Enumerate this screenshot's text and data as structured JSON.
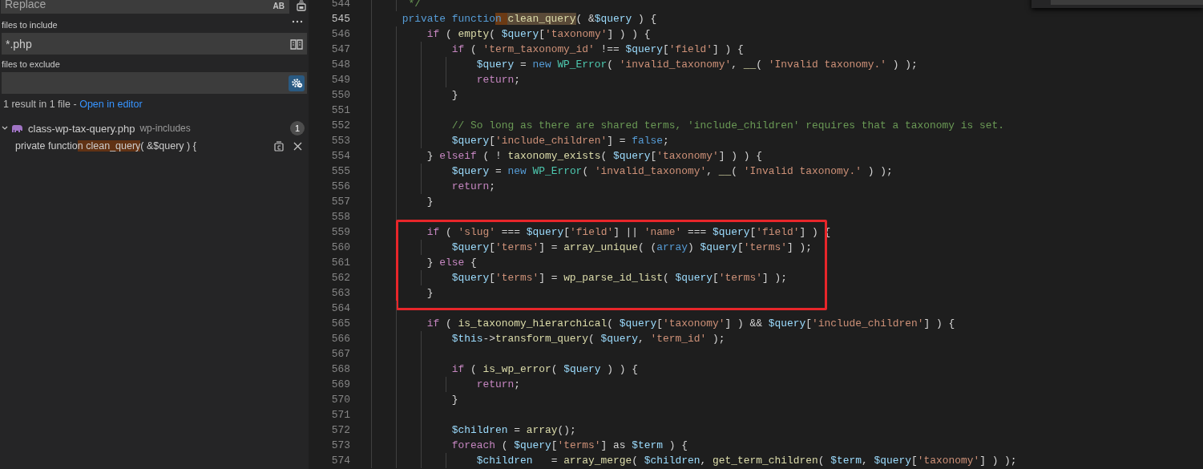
{
  "sidebar": {
    "replace_field": {
      "placeholder": "Replace",
      "case_button": "AB"
    },
    "include_field": {
      "label": "files to include",
      "value": "*.php",
      "toggle": {
        "selected": false
      }
    },
    "exclude_field": {
      "label": "files to exclude",
      "toggle": {
        "selected": true
      }
    },
    "summary": {
      "text": "1 result in 1 file - ",
      "link": "Open in editor"
    },
    "files": [
      {
        "name": "class-wp-tax-query.php",
        "folder": "wp-includes",
        "count": "1",
        "expanded": true,
        "matches": [
          {
            "segments": [
              {
                "text": "private functio",
                "match": false
              },
              {
                "text": "n clean_query",
                "match": true
              },
              {
                "text": "( &$query ) {",
                "match": false
              }
            ]
          }
        ]
      }
    ]
  },
  "editor": {
    "lines": [
      {
        "number": "544",
        "current": false,
        "boxed": false,
        "tokens": [
          {
            "kind": "comment",
            "text": "     */"
          }
        ]
      },
      {
        "number": "545",
        "current": true,
        "boxed": false,
        "tokens": [
          {
            "kind": "storage",
            "text": "    private functio"
          },
          {
            "kind": "match",
            "text": "n "
          },
          {
            "kind": "word",
            "text": "clean_query"
          },
          {
            "kind": "plain",
            "text": "( &"
          },
          {
            "kind": "var",
            "text": "$query"
          },
          {
            "kind": "plain",
            "text": " ) {"
          }
        ]
      },
      {
        "number": "546",
        "current": false,
        "boxed": false,
        "tokens": [
          {
            "kind": "control",
            "text": "        if"
          },
          {
            "kind": "plain",
            "text": " ( "
          },
          {
            "kind": "func",
            "text": "empty"
          },
          {
            "kind": "plain",
            "text": "( "
          },
          {
            "kind": "var",
            "text": "$query"
          },
          {
            "kind": "plain",
            "text": "["
          },
          {
            "kind": "string",
            "text": "'taxonomy'"
          },
          {
            "kind": "plain",
            "text": "] ) ) {"
          }
        ]
      },
      {
        "number": "547",
        "current": false,
        "boxed": false,
        "tokens": [
          {
            "kind": "control",
            "text": "            if"
          },
          {
            "kind": "plain",
            "text": " ( "
          },
          {
            "kind": "string",
            "text": "'term_taxonomy_id'"
          },
          {
            "kind": "plain",
            "text": " !== "
          },
          {
            "kind": "var",
            "text": "$query"
          },
          {
            "kind": "plain",
            "text": "["
          },
          {
            "kind": "string",
            "text": "'field'"
          },
          {
            "kind": "plain",
            "text": "] ) {"
          }
        ]
      },
      {
        "number": "548",
        "current": false,
        "boxed": false,
        "tokens": [
          {
            "kind": "var",
            "text": "                $query"
          },
          {
            "kind": "plain",
            "text": " = "
          },
          {
            "kind": "storage",
            "text": "new "
          },
          {
            "kind": "class",
            "text": "WP_Error"
          },
          {
            "kind": "plain",
            "text": "( "
          },
          {
            "kind": "string",
            "text": "'invalid_taxonomy'"
          },
          {
            "kind": "plain",
            "text": ", "
          },
          {
            "kind": "func",
            "text": "__"
          },
          {
            "kind": "plain",
            "text": "( "
          },
          {
            "kind": "string",
            "text": "'Invalid taxonomy.'"
          },
          {
            "kind": "plain",
            "text": " ) );"
          }
        ]
      },
      {
        "number": "549",
        "current": false,
        "boxed": false,
        "tokens": [
          {
            "kind": "control",
            "text": "                return"
          },
          {
            "kind": "plain",
            "text": ";"
          }
        ]
      },
      {
        "number": "550",
        "current": false,
        "boxed": false,
        "tokens": [
          {
            "kind": "plain",
            "text": "            }"
          }
        ]
      },
      {
        "number": "551",
        "current": false,
        "boxed": false
      },
      {
        "number": "552",
        "current": false,
        "boxed": false,
        "tokens": [
          {
            "kind": "comment",
            "text": "            // So long as there are shared terms, 'include_children' requires that a taxonomy is set."
          }
        ]
      },
      {
        "number": "553",
        "current": false,
        "boxed": false,
        "tokens": [
          {
            "kind": "var",
            "text": "            $query"
          },
          {
            "kind": "plain",
            "text": "["
          },
          {
            "kind": "string",
            "text": "'include_children'"
          },
          {
            "kind": "plain",
            "text": "] = "
          },
          {
            "kind": "storage",
            "text": "false"
          },
          {
            "kind": "plain",
            "text": ";"
          }
        ]
      },
      {
        "number": "554",
        "current": false,
        "boxed": false,
        "tokens": [
          {
            "kind": "plain",
            "text": "        } "
          },
          {
            "kind": "control",
            "text": "elseif"
          },
          {
            "kind": "plain",
            "text": " ( ! "
          },
          {
            "kind": "func",
            "text": "taxonomy_exists"
          },
          {
            "kind": "plain",
            "text": "( "
          },
          {
            "kind": "var",
            "text": "$query"
          },
          {
            "kind": "plain",
            "text": "["
          },
          {
            "kind": "string",
            "text": "'taxonomy'"
          },
          {
            "kind": "plain",
            "text": "] ) ) {"
          }
        ]
      },
      {
        "number": "555",
        "current": false,
        "boxed": false,
        "tokens": [
          {
            "kind": "var",
            "text": "            $query"
          },
          {
            "kind": "plain",
            "text": " = "
          },
          {
            "kind": "storage",
            "text": "new "
          },
          {
            "kind": "class",
            "text": "WP_Error"
          },
          {
            "kind": "plain",
            "text": "( "
          },
          {
            "kind": "string",
            "text": "'invalid_taxonomy'"
          },
          {
            "kind": "plain",
            "text": ", "
          },
          {
            "kind": "func",
            "text": "__"
          },
          {
            "kind": "plain",
            "text": "( "
          },
          {
            "kind": "string",
            "text": "'Invalid taxonomy.'"
          },
          {
            "kind": "plain",
            "text": " ) );"
          }
        ]
      },
      {
        "number": "556",
        "current": false,
        "boxed": false,
        "tokens": [
          {
            "kind": "control",
            "text": "            return"
          },
          {
            "kind": "plain",
            "text": ";"
          }
        ]
      },
      {
        "number": "557",
        "current": false,
        "boxed": false,
        "tokens": [
          {
            "kind": "plain",
            "text": "        }"
          }
        ]
      },
      {
        "number": "558",
        "current": false,
        "boxed": false
      },
      {
        "number": "559",
        "current": false,
        "boxed": true,
        "tokens": [
          {
            "kind": "control",
            "text": "        if"
          },
          {
            "kind": "plain",
            "text": " ( "
          },
          {
            "kind": "string",
            "text": "'slug'"
          },
          {
            "kind": "plain",
            "text": " === "
          },
          {
            "kind": "var",
            "text": "$query"
          },
          {
            "kind": "plain",
            "text": "["
          },
          {
            "kind": "string",
            "text": "'field'"
          },
          {
            "kind": "plain",
            "text": "] || "
          },
          {
            "kind": "string",
            "text": "'name'"
          },
          {
            "kind": "plain",
            "text": " === "
          },
          {
            "kind": "var",
            "text": "$query"
          },
          {
            "kind": "plain",
            "text": "["
          },
          {
            "kind": "string",
            "text": "'field'"
          },
          {
            "kind": "plain",
            "text": "] ) {"
          }
        ]
      },
      {
        "number": "560",
        "current": false,
        "boxed": true,
        "tokens": [
          {
            "kind": "var",
            "text": "            $query"
          },
          {
            "kind": "plain",
            "text": "["
          },
          {
            "kind": "string",
            "text": "'terms'"
          },
          {
            "kind": "plain",
            "text": "] = "
          },
          {
            "kind": "func",
            "text": "array_unique"
          },
          {
            "kind": "plain",
            "text": "( ("
          },
          {
            "kind": "storage",
            "text": "array"
          },
          {
            "kind": "plain",
            "text": ") "
          },
          {
            "kind": "var",
            "text": "$query"
          },
          {
            "kind": "plain",
            "text": "["
          },
          {
            "kind": "string",
            "text": "'terms'"
          },
          {
            "kind": "plain",
            "text": "] );"
          }
        ]
      },
      {
        "number": "561",
        "current": false,
        "boxed": true,
        "tokens": [
          {
            "kind": "plain",
            "text": "        } "
          },
          {
            "kind": "control",
            "text": "else"
          },
          {
            "kind": "plain",
            "text": " {"
          }
        ]
      },
      {
        "number": "562",
        "current": false,
        "boxed": true,
        "tokens": [
          {
            "kind": "var",
            "text": "            $query"
          },
          {
            "kind": "plain",
            "text": "["
          },
          {
            "kind": "string",
            "text": "'terms'"
          },
          {
            "kind": "plain",
            "text": "] = "
          },
          {
            "kind": "func",
            "text": "wp_parse_id_list"
          },
          {
            "kind": "plain",
            "text": "( "
          },
          {
            "kind": "var",
            "text": "$query"
          },
          {
            "kind": "plain",
            "text": "["
          },
          {
            "kind": "string",
            "text": "'terms'"
          },
          {
            "kind": "plain",
            "text": "] );"
          }
        ]
      },
      {
        "number": "563",
        "current": false,
        "boxed": true,
        "tokens": [
          {
            "kind": "plain",
            "text": "        }"
          }
        ]
      },
      {
        "number": "564",
        "current": false,
        "boxed": false
      },
      {
        "number": "565",
        "current": false,
        "boxed": false,
        "tokens": [
          {
            "kind": "control",
            "text": "        if"
          },
          {
            "kind": "plain",
            "text": " ( "
          },
          {
            "kind": "func",
            "text": "is_taxonomy_hierarchical"
          },
          {
            "kind": "plain",
            "text": "( "
          },
          {
            "kind": "var",
            "text": "$query"
          },
          {
            "kind": "plain",
            "text": "["
          },
          {
            "kind": "string",
            "text": "'taxonomy'"
          },
          {
            "kind": "plain",
            "text": "] ) && "
          },
          {
            "kind": "var",
            "text": "$query"
          },
          {
            "kind": "plain",
            "text": "["
          },
          {
            "kind": "string",
            "text": "'include_children'"
          },
          {
            "kind": "plain",
            "text": "] ) {"
          }
        ]
      },
      {
        "number": "566",
        "current": false,
        "boxed": false,
        "tokens": [
          {
            "kind": "var",
            "text": "            $this"
          },
          {
            "kind": "plain",
            "text": "->"
          },
          {
            "kind": "func",
            "text": "transform_query"
          },
          {
            "kind": "plain",
            "text": "( "
          },
          {
            "kind": "var",
            "text": "$query"
          },
          {
            "kind": "plain",
            "text": ", "
          },
          {
            "kind": "string",
            "text": "'term_id'"
          },
          {
            "kind": "plain",
            "text": " );"
          }
        ]
      },
      {
        "number": "567",
        "current": false,
        "boxed": false
      },
      {
        "number": "568",
        "current": false,
        "boxed": false,
        "tokens": [
          {
            "kind": "control",
            "text": "            if"
          },
          {
            "kind": "plain",
            "text": " ( "
          },
          {
            "kind": "func",
            "text": "is_wp_error"
          },
          {
            "kind": "plain",
            "text": "( "
          },
          {
            "kind": "var",
            "text": "$query"
          },
          {
            "kind": "plain",
            "text": " ) ) {"
          }
        ]
      },
      {
        "number": "569",
        "current": false,
        "boxed": false,
        "tokens": [
          {
            "kind": "control",
            "text": "                return"
          },
          {
            "kind": "plain",
            "text": ";"
          }
        ]
      },
      {
        "number": "570",
        "current": false,
        "boxed": false,
        "tokens": [
          {
            "kind": "plain",
            "text": "            }"
          }
        ]
      },
      {
        "number": "571",
        "current": false,
        "boxed": false
      },
      {
        "number": "572",
        "current": false,
        "boxed": false,
        "tokens": [
          {
            "kind": "var",
            "text": "            $children"
          },
          {
            "kind": "plain",
            "text": " = "
          },
          {
            "kind": "func",
            "text": "array"
          },
          {
            "kind": "plain",
            "text": "();"
          }
        ]
      },
      {
        "number": "573",
        "current": false,
        "boxed": false,
        "tokens": [
          {
            "kind": "control",
            "text": "            foreach"
          },
          {
            "kind": "plain",
            "text": " ( "
          },
          {
            "kind": "var",
            "text": "$query"
          },
          {
            "kind": "plain",
            "text": "["
          },
          {
            "kind": "string",
            "text": "'terms'"
          },
          {
            "kind": "plain",
            "text": "] as "
          },
          {
            "kind": "var",
            "text": "$term"
          },
          {
            "kind": "plain",
            "text": " ) {"
          }
        ]
      },
      {
        "number": "574",
        "current": false,
        "boxed": false,
        "tokens": [
          {
            "kind": "var",
            "text": "                $children"
          },
          {
            "kind": "plain",
            "text": "   = "
          },
          {
            "kind": "func",
            "text": "array_merge"
          },
          {
            "kind": "plain",
            "text": "( "
          },
          {
            "kind": "var",
            "text": "$children"
          },
          {
            "kind": "plain",
            "text": ", "
          },
          {
            "kind": "func",
            "text": "get_term_children"
          },
          {
            "kind": "plain",
            "text": "( "
          },
          {
            "kind": "var",
            "text": "$term"
          },
          {
            "kind": "plain",
            "text": ", "
          },
          {
            "kind": "var",
            "text": "$query"
          },
          {
            "kind": "plain",
            "text": "["
          },
          {
            "kind": "string",
            "text": "'taxonomy'"
          },
          {
            "kind": "plain",
            "text": "] ) );"
          }
        ]
      }
    ]
  }
}
